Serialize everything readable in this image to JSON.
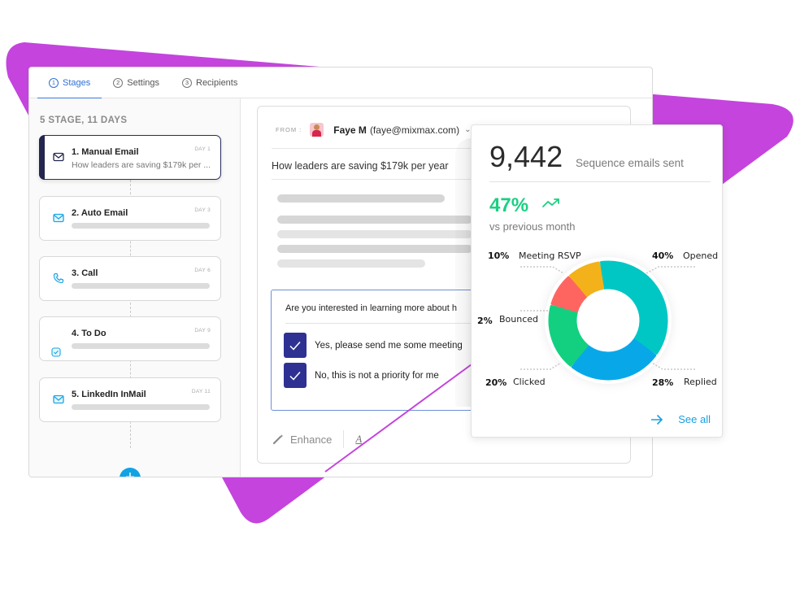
{
  "colors": {
    "background_shape": "#c444dd",
    "accent_blue": "#3a7be0",
    "stage_active": "#23264f",
    "add_button": "#11a3e4",
    "checkbox": "#2e3192",
    "growth_green": "#1ccf83",
    "link_blue": "#1aa0df"
  },
  "tabs": [
    {
      "num": "1",
      "label": "Stages",
      "active": true
    },
    {
      "num": "2",
      "label": "Settings",
      "active": false
    },
    {
      "num": "3",
      "label": "Recipients",
      "active": false
    }
  ],
  "sidebar": {
    "summary": "5 STAGE, 11 DAYS",
    "stages": [
      {
        "title": "1. Manual Email",
        "day": "DAY 1",
        "subtitle": "How leaders are saving $179k per ...",
        "icon": "envelope-icon",
        "active": true
      },
      {
        "title": "2. Auto Email",
        "day": "DAY 3",
        "icon": "envelope-icon",
        "active": false
      },
      {
        "title": "3. Call",
        "day": "DAY 6",
        "icon": "phone-icon",
        "active": false
      },
      {
        "title": "4. To Do",
        "day": "DAY 9",
        "icon": "checkbox-icon",
        "active": false
      },
      {
        "title": "5. LinkedIn InMail",
        "day": "DAY 11",
        "icon": "envelope-icon",
        "active": false
      }
    ],
    "add_button": "+"
  },
  "email": {
    "from_label": "FROM :",
    "sender_name": "Faye M",
    "sender_email": "(faye@mixmax.com)",
    "subject": "How leaders are saving $179k per year",
    "poll": {
      "question": "Are you interested in learning more about h",
      "options": [
        {
          "label": "Yes, please send me some meeting",
          "checked": true
        },
        {
          "label": "No, this is not a priority for me",
          "checked": true
        }
      ]
    },
    "toolbar": {
      "enhance_label": "Enhance",
      "font_label": "A"
    }
  },
  "stats": {
    "total": "9,442",
    "total_label": "Sequence emails sent",
    "growth": "47%",
    "growth_label": "vs previous month",
    "see_all": "See all"
  },
  "chart_data": {
    "type": "pie",
    "variant": "donut",
    "title": "",
    "categories": [
      "Opened",
      "Replied",
      "Clicked",
      "Bounced",
      "Meeting RSVP"
    ],
    "values": [
      40,
      28,
      20,
      2,
      10
    ],
    "labels": [
      "40%",
      "28%",
      "20%",
      "2%",
      "10%"
    ],
    "colors": [
      "#00c7c4",
      "#08a8e8",
      "#13d081",
      "#ff6560",
      "#f3b21a"
    ],
    "legend": "around-chart"
  }
}
